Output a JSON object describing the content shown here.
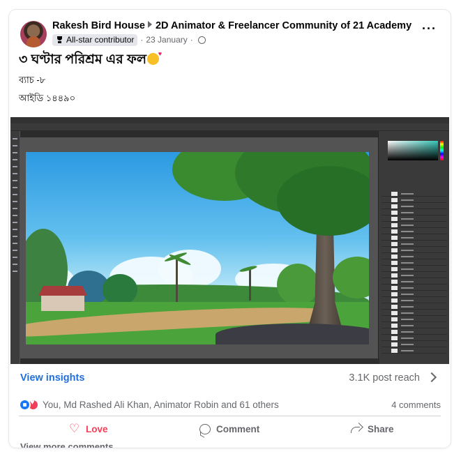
{
  "post": {
    "author": "Rakesh Bird House",
    "group": "2D Animator & Freelancer Community of 21 Academy",
    "badge": "All-star contributor",
    "date": "23 January",
    "privacy_icon": "globe-icon",
    "title": "৩ ঘণ্টার পরিশ্রম এর ফল",
    "line1": "ব্যাচ -৮",
    "line2": "আইডি ১৪৪৯০"
  },
  "image": {
    "description_icon": "photoshop-screenshot"
  },
  "footer": {
    "insights": "View insights",
    "reach": "3.1K post reach",
    "reactions_text": "You, Md Rashed Ali Khan, Animator Robin and 61 others",
    "comments": "4 comments",
    "love_label": "Love",
    "comment_label": "Comment",
    "share_label": "Share",
    "view_more": "View more comments"
  },
  "colors": {
    "link_blue": "#216fdb",
    "love_red": "#f33e58",
    "like_blue": "#1877f2"
  }
}
